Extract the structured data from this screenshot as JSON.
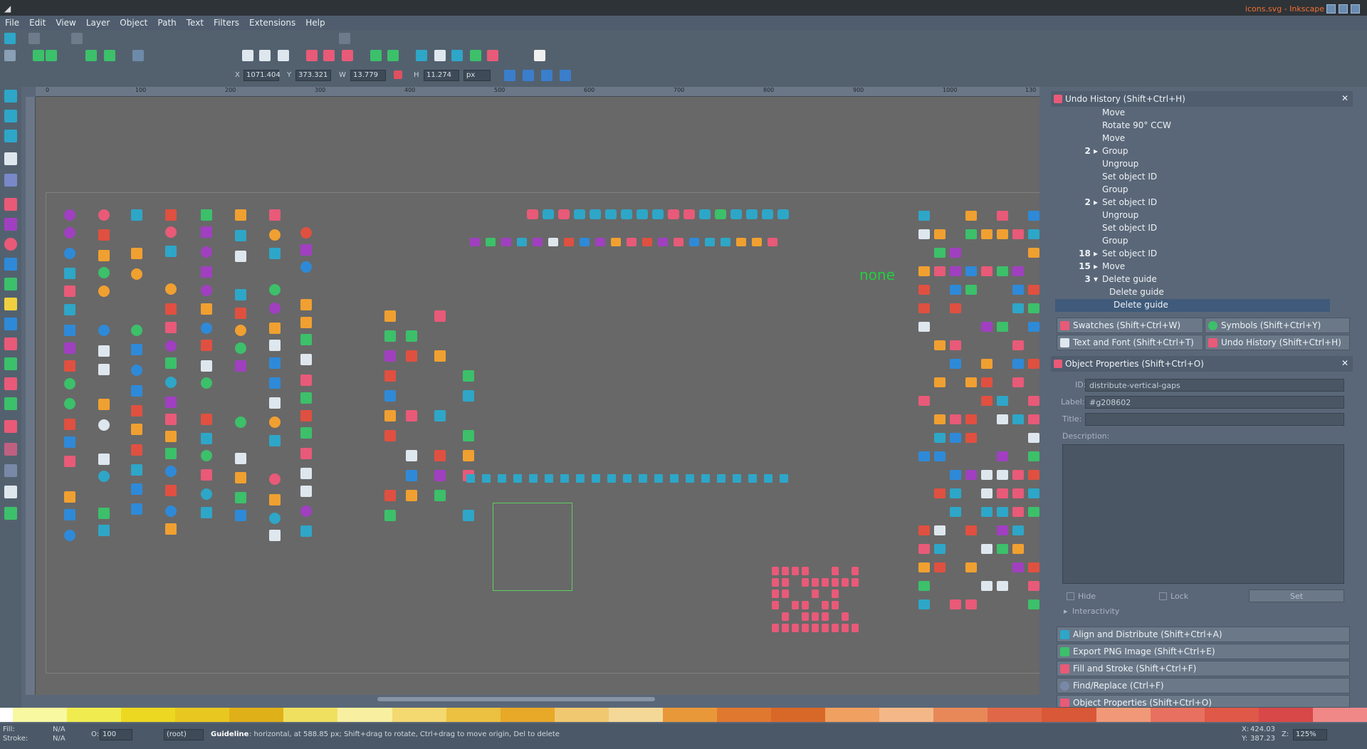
{
  "window": {
    "title": "icons.svg - Inkscape",
    "app_icon": "inkscape-logo-icon"
  },
  "menu": [
    "File",
    "Edit",
    "View",
    "Layer",
    "Object",
    "Path",
    "Text",
    "Filters",
    "Extensions",
    "Help"
  ],
  "ctrl": {
    "x_label": "X",
    "x_value": "1071.404",
    "y_label": "Y",
    "y_value": "373.321",
    "w_label": "W",
    "w_value": "13.779",
    "h_label": "H",
    "h_value": "11.274",
    "unit": "px"
  },
  "ruler_top": [
    "0",
    "100",
    "200",
    "300",
    "400",
    "500",
    "600",
    "700",
    "800",
    "900",
    "1000",
    "1100",
    "130"
  ],
  "canvas_text": {
    "none_label": "none"
  },
  "undo_history": {
    "title": "Undo History (Shift+Ctrl+H)",
    "rows": [
      {
        "count": "",
        "label": "Move"
      },
      {
        "count": "",
        "label": "Rotate 90° CCW"
      },
      {
        "count": "",
        "label": "Move"
      },
      {
        "count": "2 ▸",
        "label": "Group"
      },
      {
        "count": "",
        "label": "Ungroup"
      },
      {
        "count": "",
        "label": "Set object ID"
      },
      {
        "count": "",
        "label": "Group"
      },
      {
        "count": "2 ▸",
        "label": "Set object ID"
      },
      {
        "count": "",
        "label": "Ungroup"
      },
      {
        "count": "",
        "label": "Set object ID"
      },
      {
        "count": "",
        "label": "Group"
      },
      {
        "count": "18 ▸",
        "label": "Set object ID"
      },
      {
        "count": "15 ▸",
        "label": "Move"
      },
      {
        "count": "3 ▾",
        "label": "Delete guide"
      },
      {
        "count": "",
        "label": "Delete guide"
      },
      {
        "count": "",
        "label": "Delete guide"
      }
    ]
  },
  "tabs": [
    {
      "label": "Swatches (Shift+Ctrl+W)",
      "icon": "swatches-icon"
    },
    {
      "label": "Symbols (Shift+Ctrl+Y)",
      "icon": "symbols-icon"
    },
    {
      "label": "Text and Font (Shift+Ctrl+T)",
      "icon": "text-font-icon"
    },
    {
      "label": "Undo History (Shift+Ctrl+H)",
      "icon": "undo-history-icon"
    }
  ],
  "object_properties": {
    "title": "Object Properties (Shift+Ctrl+O)",
    "id_label": "ID:",
    "id_value": "distribute-vertical-gaps",
    "label_label": "Label:",
    "label_value": "#g208602",
    "title_label": "Title:",
    "title_value": "",
    "description_label": "Description:",
    "hide_label": "Hide",
    "lock_label": "Lock",
    "set_label": "Set",
    "interactivity_label": "Interactivity"
  },
  "collapsed_docks": [
    "Align and Distribute (Shift+Ctrl+A)",
    "Export PNG Image (Shift+Ctrl+E)",
    "Fill and Stroke (Shift+Ctrl+F)",
    "Find/Replace (Ctrl+F)",
    "Object Properties (Shift+Ctrl+O)"
  ],
  "palette_colors": [
    "#f8f8a0",
    "#f0ec50",
    "#ecd820",
    "#e8c820",
    "#e0b018",
    "#f0e060",
    "#f8f0a0",
    "#f4d870",
    "#ecc040",
    "#e8a828",
    "#f0c870",
    "#f4d898",
    "#e89838",
    "#e07830",
    "#d86828",
    "#f0a060",
    "#f4b888",
    "#e88858",
    "#e06848",
    "#d85838",
    "#f09878",
    "#e87060",
    "#e05848",
    "#d84848",
    "#f08888"
  ],
  "status": {
    "fill_label": "Fill:",
    "fill_value": "N/A",
    "stroke_label": "Stroke:",
    "stroke_value": "N/A",
    "opacity_label": "O:",
    "opacity_value": "100",
    "layer": "(root)",
    "message_bold": "Guideline",
    "message": ": horizontal, at 588.85 px; Shift+drag to rotate, Ctrl+drag to move origin, Del to delete",
    "x_label": "X:",
    "x_value": "424.03",
    "y_label": "Y:",
    "y_value": "387.23",
    "zoom_label": "Z:",
    "zoom_value": "125%"
  }
}
